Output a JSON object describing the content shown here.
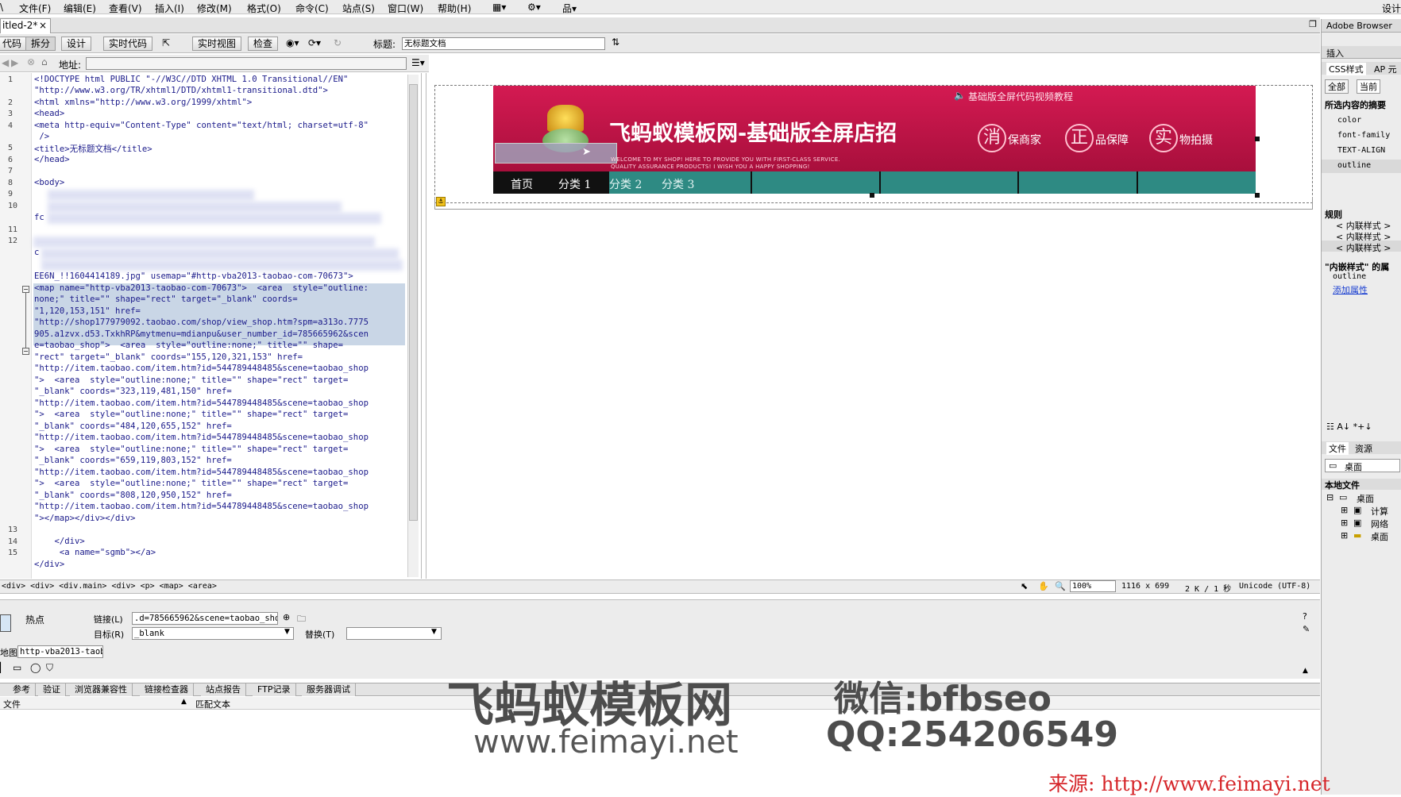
{
  "menu": [
    "文件(F)",
    "编辑(E)",
    "查看(V)",
    "插入(I)",
    "修改(M)",
    "格式(O)",
    "命令(C)",
    "站点(S)",
    "窗口(W)",
    "帮助(H)"
  ],
  "menubar_right": "设计",
  "doc_tab": {
    "label": "itled-2*",
    "close": "×"
  },
  "toolbar": {
    "buttons": [
      "代码",
      "拆分",
      "设计",
      "实时代码",
      "实时视图",
      "检查"
    ],
    "title_label": "标题:",
    "title_value": "无标题文档"
  },
  "addressbar": {
    "label": "地址:",
    "value": ""
  },
  "code": {
    "line_numbers": [
      "1",
      "2",
      "3",
      "4",
      "5",
      "6",
      "7",
      "8",
      "9",
      "10",
      "11",
      "12",
      "13",
      "14",
      "15"
    ],
    "lines": [
      "<!DOCTYPE html PUBLIC \"-//W3C//DTD XHTML 1.0 Transitional//EN\"",
      "\"http://www.w3.org/TR/xhtml1/DTD/xhtml1-transitional.dtd\">",
      "<html xmlns=\"http://www.w3.org/1999/xhtml\">",
      "<head>",
      "<meta http-equiv=\"Content-Type\" content=\"text/html; charset=utf-8\"",
      " />",
      "<title>无标题文档</title>",
      "</head>",
      "",
      "<body>",
      "",
      "fc",
      "",
      "",
      "c",
      "EE6N_!!1604414189.jpg\" usemap=\"#http-vba2013-taobao-com-70673\">",
      "<map name=\"http-vba2013-taobao-com-70673\">  <area  style=\"outline:",
      "none;\" title=\"\" shape=\"rect\" target=\"_blank\" coords=",
      "\"1,120,153,151\" href=",
      "\"http://shop177979092.taobao.com/shop/view_shop.htm?spm=a313o.7775",
      "905.a1zvx.d53.TxkhRP&mytmenu=mdianpu&user_number_id=785665962&scen",
      "e=taobao_shop\">  <area  style=\"outline:none;\" title=\"\" shape=",
      "\"rect\" target=\"_blank\" coords=\"155,120,321,153\" href=",
      "\"http://item.taobao.com/item.htm?id=544789448485&scene=taobao_shop",
      "\">  <area  style=\"outline:none;\" title=\"\" shape=\"rect\" target=",
      "\"_blank\" coords=\"323,119,481,150\" href=",
      "\"http://item.taobao.com/item.htm?id=544789448485&scene=taobao_shop",
      "\">  <area  style=\"outline:none;\" title=\"\" shape=\"rect\" target=",
      "\"_blank\" coords=\"484,120,655,152\" href=",
      "\"http://item.taobao.com/item.htm?id=544789448485&scene=taobao_shop",
      "\">  <area  style=\"outline:none;\" title=\"\" shape=\"rect\" target=",
      "\"_blank\" coords=\"659,119,803,152\" href=",
      "\"http://item.taobao.com/item.htm?id=544789448485&scene=taobao_shop",
      "\">  <area  style=\"outline:none;\" title=\"\" shape=\"rect\" target=",
      "\"_blank\" coords=\"808,120,950,152\" href=",
      "\"http://item.taobao.com/item.htm?id=544789448485&scene=taobao_shop",
      "\"></map></div></div>",
      "",
      "    </div>",
      "     <a name=\"sgmb\"></a>",
      "</div>"
    ]
  },
  "banner": {
    "title": "飞蚂蚁模板网-基础版全屏店招",
    "video_link": "基础版全屏代码视频教程",
    "welcome_line1": "WELCOME TO MY SHOP! HERE TO PROVIDE YOU WITH FIRST-CLASS SERVICE.",
    "welcome_line2": "QUALITY ASSURANCE PRODUCTS! I WISH YOU A HAPPY SHOPPING!",
    "badges": [
      {
        "char": "消",
        "text": "保商家"
      },
      {
        "char": "正",
        "text": "品保障"
      },
      {
        "char": "实",
        "text": "物拍摄"
      }
    ],
    "nav": [
      "首页",
      "分类 1",
      "分类 2",
      "分类 3"
    ],
    "colors": {
      "banner": "#c8154a",
      "nav": "#2e8a83"
    }
  },
  "statusbar": {
    "tags": "<div> <div> <div.main> <div> <p> <map> <area>",
    "zoom": "100%",
    "size": "1116 x 699",
    "filesize": "2 K / 1 秒",
    "encoding": "Unicode (UTF-8)"
  },
  "properties": {
    "type": "热点",
    "link_label": "链接(L)",
    "link_value": ".d=785665962&scene=taobao_shop",
    "target_label": "目标(R)",
    "target_value": "_blank",
    "alt_label": "替换(T)",
    "alt_value": "",
    "map_label": "地图",
    "map_value": "http-vba2013-taob"
  },
  "reports": {
    "tabs": [
      "参考",
      "验证",
      "浏览器兼容性",
      "链接检查器",
      "站点报告",
      "FTP记录",
      "服务器调试"
    ],
    "col_file": "文件",
    "col_match": "匹配文本"
  },
  "right_panel": {
    "title": "Adobe Browser",
    "insert": "插入",
    "css_tab": "CSS样式",
    "ap_tab": "AP 元",
    "all_btn": "全部",
    "current_btn": "当前",
    "summary_title": "所选内容的摘要",
    "props": [
      "color",
      "font-family",
      "TEXT-ALIGN",
      "outline"
    ],
    "rules_title": "规则",
    "rules": [
      "< 内联样式 >",
      "< 内联样式 >",
      "< 内联样式 >"
    ],
    "inline_title": "\"内嵌样式\" 的属",
    "inline_prop": "outline",
    "add_prop": "添加属性",
    "files_tab": "文件",
    "assets_tab": "资源",
    "desktop_select": "桌面",
    "local_files": "本地文件",
    "tree": [
      "桌面",
      "计算",
      "网络",
      "桌面"
    ]
  },
  "watermark": {
    "brand": "飞蚂蚁模板网",
    "site": "www.feimayi.net",
    "wechat": "微信:bfbseo",
    "qq": "QQ:254206549",
    "source": "来源: http://www.feimayi.net"
  }
}
